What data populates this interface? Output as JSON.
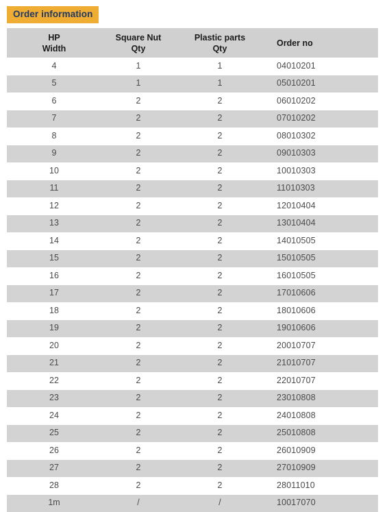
{
  "title_badge": {
    "label": "Order information",
    "background_color": "#efad34",
    "text_color": "#1f3864"
  },
  "table": {
    "header_background": "#d0d0d0",
    "stripe_background": "#d3d3d3",
    "columns": [
      {
        "id": "hp_width",
        "line1": "HP",
        "line2": "Width",
        "align": "center"
      },
      {
        "id": "square_nut",
        "line1": "Square Nut",
        "line2": "Qty",
        "align": "center"
      },
      {
        "id": "plastic_parts",
        "line1": "Plastic parts",
        "line2": "Qty",
        "align": "center"
      },
      {
        "id": "order_no",
        "line1": "Order no",
        "line2": "",
        "align": "left"
      }
    ],
    "rows": [
      {
        "hp_width": "4",
        "square_nut": "1",
        "plastic_parts": "1",
        "order_no": "04010201"
      },
      {
        "hp_width": "5",
        "square_nut": "1",
        "plastic_parts": "1",
        "order_no": "05010201"
      },
      {
        "hp_width": "6",
        "square_nut": "2",
        "plastic_parts": "2",
        "order_no": "06010202"
      },
      {
        "hp_width": "7",
        "square_nut": "2",
        "plastic_parts": "2",
        "order_no": "07010202"
      },
      {
        "hp_width": "8",
        "square_nut": "2",
        "plastic_parts": "2",
        "order_no": "08010302"
      },
      {
        "hp_width": "9",
        "square_nut": "2",
        "plastic_parts": "2",
        "order_no": "09010303"
      },
      {
        "hp_width": "10",
        "square_nut": "2",
        "plastic_parts": "2",
        "order_no": "10010303"
      },
      {
        "hp_width": "11",
        "square_nut": "2",
        "plastic_parts": "2",
        "order_no": "11010303"
      },
      {
        "hp_width": "12",
        "square_nut": "2",
        "plastic_parts": "2",
        "order_no": "12010404"
      },
      {
        "hp_width": "13",
        "square_nut": "2",
        "plastic_parts": "2",
        "order_no": "13010404"
      },
      {
        "hp_width": "14",
        "square_nut": "2",
        "plastic_parts": "2",
        "order_no": "14010505"
      },
      {
        "hp_width": "15",
        "square_nut": "2",
        "plastic_parts": "2",
        "order_no": "15010505"
      },
      {
        "hp_width": "16",
        "square_nut": "2",
        "plastic_parts": "2",
        "order_no": "16010505"
      },
      {
        "hp_width": "17",
        "square_nut": "2",
        "plastic_parts": "2",
        "order_no": "17010606"
      },
      {
        "hp_width": "18",
        "square_nut": "2",
        "plastic_parts": "2",
        "order_no": "18010606"
      },
      {
        "hp_width": "19",
        "square_nut": "2",
        "plastic_parts": "2",
        "order_no": "19010606"
      },
      {
        "hp_width": "20",
        "square_nut": "2",
        "plastic_parts": "2",
        "order_no": "20010707"
      },
      {
        "hp_width": "21",
        "square_nut": "2",
        "plastic_parts": "2",
        "order_no": "21010707"
      },
      {
        "hp_width": "22",
        "square_nut": "2",
        "plastic_parts": "2",
        "order_no": "22010707"
      },
      {
        "hp_width": "23",
        "square_nut": "2",
        "plastic_parts": "2",
        "order_no": "23010808"
      },
      {
        "hp_width": "24",
        "square_nut": "2",
        "plastic_parts": "2",
        "order_no": "24010808"
      },
      {
        "hp_width": "25",
        "square_nut": "2",
        "plastic_parts": "2",
        "order_no": "25010808"
      },
      {
        "hp_width": "26",
        "square_nut": "2",
        "plastic_parts": "2",
        "order_no": "26010909"
      },
      {
        "hp_width": "27",
        "square_nut": "2",
        "plastic_parts": "2",
        "order_no": "27010909"
      },
      {
        "hp_width": "28",
        "square_nut": "2",
        "plastic_parts": "2",
        "order_no": "28011010"
      },
      {
        "hp_width": "1m",
        "square_nut": "/",
        "plastic_parts": "/",
        "order_no": "10017070"
      }
    ]
  }
}
